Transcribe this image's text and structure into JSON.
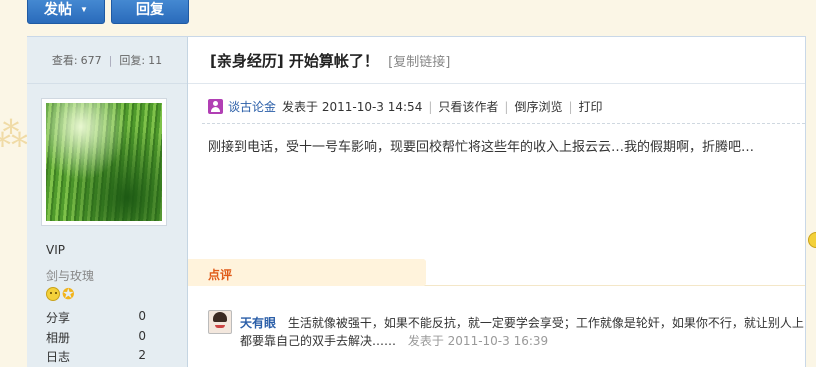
{
  "buttons": {
    "post": "发帖",
    "reply": "回复"
  },
  "stats": {
    "views_label": "查看:",
    "views": "677",
    "replies_label": "回复:",
    "replies": "11"
  },
  "thread": {
    "title": "[亲身经历] 开始算帐了！",
    "copy_link": "[复制链接]"
  },
  "post": {
    "author": "谈古论金",
    "posted": "发表于 2011-10-3 14:54",
    "only_author": "只看该作者",
    "reverse": "倒序浏览",
    "print": "打印",
    "body": "刚接到电话，受十一号车影响，现要回校帮忙将这些年的收入上报云云…我的假期啊，折腾吧…"
  },
  "user": {
    "group": "VIP",
    "nickname": "剑与玫瑰",
    "profile": [
      {
        "label": "分享",
        "value": "0"
      },
      {
        "label": "相册",
        "value": "0"
      },
      {
        "label": "日志",
        "value": "2"
      }
    ]
  },
  "comment_section": {
    "title": "点评"
  },
  "comment": {
    "user": "天有眼",
    "text1": "生活就像被强干，如果不能反抗，就一定要学会享受；工作就像是轮奸，如果你不行，就让别人上",
    "text2": "都要靠自己的双手去解决……",
    "time": "发表于 2011-10-3 16:39"
  }
}
